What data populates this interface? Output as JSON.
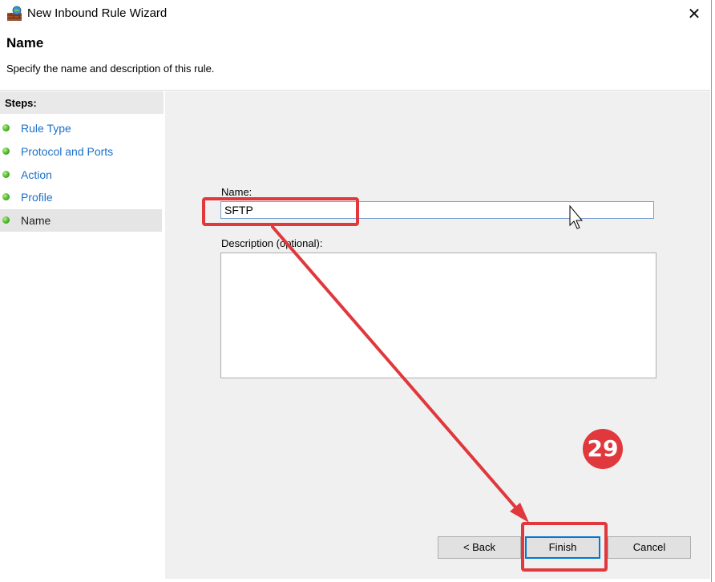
{
  "window": {
    "title": "New Inbound Rule Wizard",
    "close_glyph": "✕",
    "icon": "firewall-icon"
  },
  "header": {
    "title": "Name",
    "subtitle": "Specify the name and description of this rule."
  },
  "steps": {
    "heading": "Steps:",
    "items": [
      {
        "label": "Rule Type",
        "current": false
      },
      {
        "label": "Protocol and Ports",
        "current": false
      },
      {
        "label": "Action",
        "current": false
      },
      {
        "label": "Profile",
        "current": false
      },
      {
        "label": "Name",
        "current": true
      }
    ]
  },
  "form": {
    "name_label": "Name:",
    "name_value": "SFTP",
    "description_label": "Description (optional):",
    "description_value": ""
  },
  "buttons": {
    "back": "< Back",
    "finish": "Finish",
    "cancel": "Cancel"
  },
  "annotation": {
    "step_number": "29",
    "color": "#e0383c"
  }
}
